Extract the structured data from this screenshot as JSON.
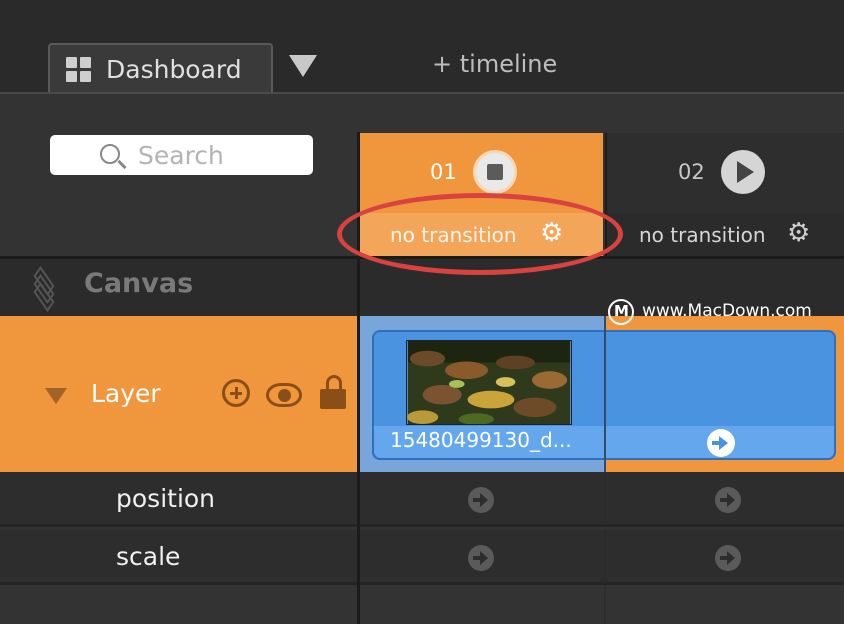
{
  "tabs": {
    "active_label": "Dashboard",
    "add_timeline_label": "+ timeline"
  },
  "search": {
    "placeholder": "Search"
  },
  "scenes": [
    {
      "number": "01",
      "transition": "no transition",
      "state": "selected",
      "control": "stop"
    },
    {
      "number": "02",
      "transition": "no transition",
      "state": "normal",
      "control": "play"
    }
  ],
  "tree": {
    "canvas_label": "Canvas",
    "layer_label": "Layer",
    "properties": [
      {
        "label": "position"
      },
      {
        "label": "scale"
      }
    ]
  },
  "clip": {
    "name": "15480499130_d..."
  },
  "watermark": {
    "text": "www.MacDown.com"
  },
  "colors": {
    "accent_orange": "#f0963c",
    "clip_blue": "#4a93e0",
    "highlight_red": "#d8433f"
  },
  "icons": [
    "grid-icon",
    "dropdown-triangle-icon",
    "search-icon",
    "stop-icon",
    "play-icon",
    "gear-icon",
    "layers-icon",
    "collapse-triangle-icon",
    "add-icon",
    "eye-icon",
    "lock-icon",
    "arrow-right-icon"
  ]
}
